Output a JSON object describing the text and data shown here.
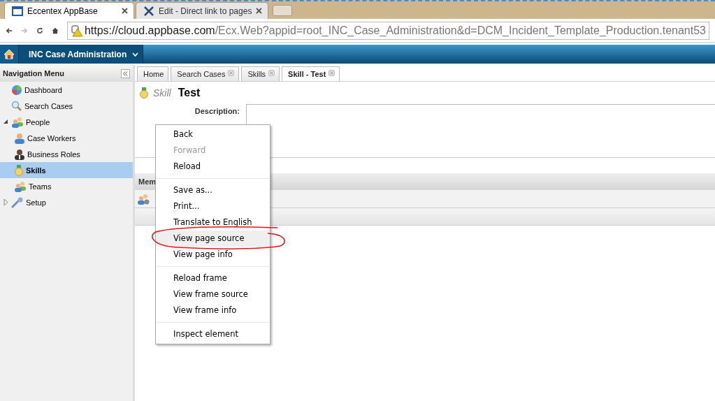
{
  "browser": {
    "tabs": [
      {
        "title": "Eccentex AppBase",
        "selected": true
      },
      {
        "title": "Edit - Direct link to pages",
        "selected": false
      }
    ],
    "url_host": "https://cloud.appbase.com",
    "url_path": "/Ecx.Web?appid=root_INC_Case_Administration&d=DCM_Incident_Template_Production.tenant53"
  },
  "app": {
    "title": "INC Case Administration"
  },
  "sidebar": {
    "title": "Navigation Menu",
    "items": [
      {
        "label": "Dashboard",
        "selected": false
      },
      {
        "label": "Search Cases",
        "selected": false
      },
      {
        "label": "People",
        "selected": false,
        "expanded": true,
        "children": [
          {
            "label": "Case Workers",
            "selected": false
          },
          {
            "label": "Business Roles",
            "selected": false
          },
          {
            "label": "Skills",
            "selected": true
          },
          {
            "label": "Teams",
            "selected": false
          }
        ]
      },
      {
        "label": "Setup",
        "selected": false,
        "expanded": false
      }
    ]
  },
  "tabs": [
    {
      "label": "Home",
      "closable": false,
      "selected": false
    },
    {
      "label": "Search Cases",
      "closable": true,
      "selected": false
    },
    {
      "label": "Skills",
      "closable": true,
      "selected": false
    },
    {
      "label": "Skill - Test",
      "closable": true,
      "selected": true
    }
  ],
  "record": {
    "type": "Skill",
    "name": "Test",
    "description_label": "Description:"
  },
  "section": {
    "title": "Mem"
  },
  "context_menu": {
    "groups": [
      [
        {
          "label": "Back",
          "disabled": false,
          "selected": false
        },
        {
          "label": "Forward",
          "disabled": true,
          "selected": false
        },
        {
          "label": "Reload",
          "disabled": false,
          "selected": false
        }
      ],
      [
        {
          "label": "Save as...",
          "disabled": false,
          "selected": false
        },
        {
          "label": "Print...",
          "disabled": false,
          "selected": false
        },
        {
          "label": "Translate to English",
          "disabled": false,
          "selected": false
        },
        {
          "label": "View page source",
          "disabled": false,
          "selected": true
        },
        {
          "label": "View page info",
          "disabled": false,
          "selected": false
        }
      ],
      [
        {
          "label": "Reload frame",
          "disabled": false,
          "selected": false
        },
        {
          "label": "View frame source",
          "disabled": false,
          "selected": false
        },
        {
          "label": "View frame info",
          "disabled": false,
          "selected": false
        }
      ],
      [
        {
          "label": "Inspect element",
          "disabled": false,
          "selected": false
        }
      ]
    ]
  }
}
